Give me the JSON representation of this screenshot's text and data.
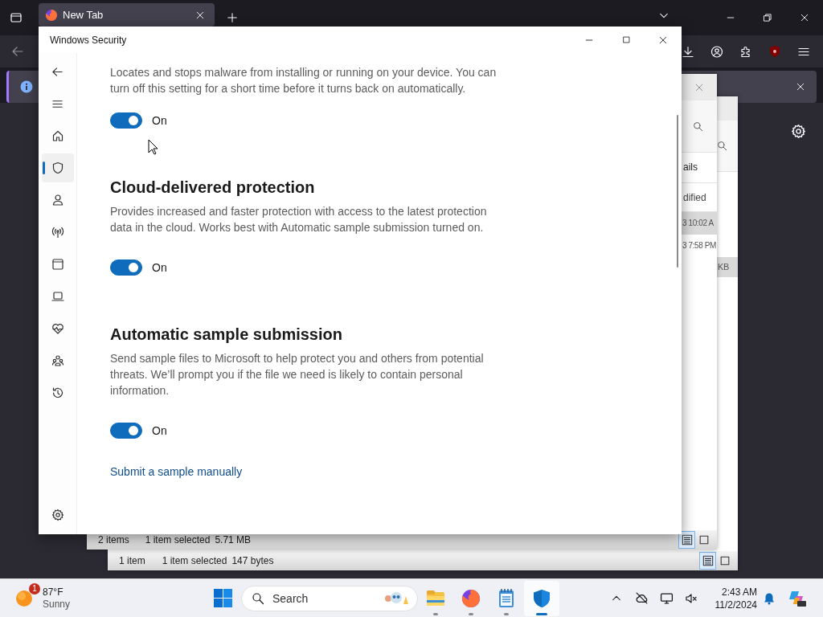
{
  "browser": {
    "tabs": [
      {
        "label": "New Tab",
        "selected": true
      }
    ]
  },
  "explorer_windows": [
    {
      "toolbar_text": "ails",
      "column_header": "dified",
      "rows": [
        {
          "cell": "3 10:02 A",
          "selected": true
        },
        {
          "cell": "3 7:58 PM",
          "selected": false
        }
      ],
      "status": [
        "2 items",
        "1 item selected",
        "5.71 MB"
      ]
    },
    {
      "rows": [
        {
          "cell": "KB",
          "selected": true
        }
      ],
      "status": [
        "1 item",
        "1 item selected",
        "147 bytes"
      ]
    }
  ],
  "security": {
    "title": "Windows Security",
    "nav": [
      {
        "kind": "home",
        "selected": false
      },
      {
        "kind": "shield",
        "selected": true
      },
      {
        "kind": "account",
        "selected": false
      },
      {
        "kind": "wireless",
        "selected": false
      },
      {
        "kind": "app-browser",
        "selected": false
      },
      {
        "kind": "device",
        "selected": false
      },
      {
        "kind": "health",
        "selected": false
      },
      {
        "kind": "family",
        "selected": false
      },
      {
        "kind": "history",
        "selected": false
      }
    ],
    "sections": [
      {
        "description": "Locates and stops malware from installing or running on your device. You can turn off this setting for a short time before it turns back on automatically.",
        "toggle": {
          "on": true,
          "label": "On"
        }
      },
      {
        "heading": "Cloud-delivered protection",
        "description": "Provides increased and faster protection with access to the latest protection data in the cloud. Works best with Automatic sample submission turned on.",
        "toggle": {
          "on": true,
          "label": "On"
        }
      },
      {
        "heading": "Automatic sample submission",
        "description": "Send sample files to Microsoft to help protect you and others from potential threats. We’ll prompt you if the file we need is likely to contain personal information.",
        "toggle": {
          "on": true,
          "label": "On"
        }
      }
    ],
    "link": "Submit a sample manually"
  },
  "taskbar": {
    "weather": {
      "badge": "1",
      "temperature": "87°F",
      "condition": "Sunny"
    },
    "search": {
      "label": "Search"
    },
    "apps": [
      {
        "kind": "explorer",
        "active": false
      },
      {
        "kind": "firefox",
        "active": false
      },
      {
        "kind": "notepad",
        "active": false
      },
      {
        "kind": "defender",
        "active": true
      }
    ],
    "clock": {
      "time": "2:43 AM",
      "date": "11/2/2024"
    }
  }
}
